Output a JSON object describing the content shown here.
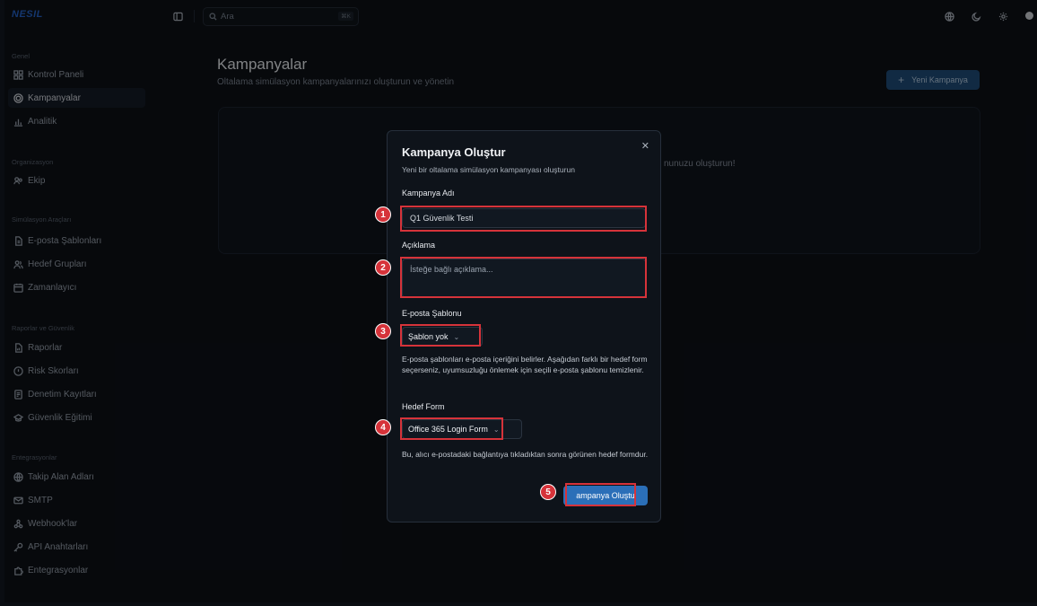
{
  "app": {
    "logo": "NESIL"
  },
  "search": {
    "placeholder": "Ara",
    "shortcut": "⌘K"
  },
  "sidebar": {
    "sections": [
      {
        "title": "Genel",
        "items": [
          {
            "label": "Kontrol Paneli",
            "icon": "dashboard-icon",
            "active": false
          },
          {
            "label": "Kampanyalar",
            "icon": "target-icon",
            "active": true
          },
          {
            "label": "Analitik",
            "icon": "bar-chart-icon",
            "active": false
          }
        ]
      },
      {
        "title": "Organizasyon",
        "items": [
          {
            "label": "Ekip",
            "icon": "users-icon",
            "active": false
          }
        ]
      },
      {
        "title": "Simülasyon Araçları",
        "items": [
          {
            "label": "E-posta Şablonları",
            "icon": "file-icon",
            "active": false
          },
          {
            "label": "Hedef Grupları",
            "icon": "user-group-icon",
            "active": false
          },
          {
            "label": "Zamanlayıcı",
            "icon": "calendar-icon",
            "active": false
          }
        ]
      },
      {
        "title": "Raporlar ve Güvenlik",
        "items": [
          {
            "label": "Raporlar",
            "icon": "report-icon",
            "active": false
          },
          {
            "label": "Risk Skorları",
            "icon": "alert-icon",
            "active": false
          },
          {
            "label": "Denetim Kayıtları",
            "icon": "log-icon",
            "active": false
          },
          {
            "label": "Güvenlik Eğitimi",
            "icon": "graduation-icon",
            "active": false
          }
        ]
      },
      {
        "title": "Entegrasyonlar",
        "items": [
          {
            "label": "Takip Alan Adları",
            "icon": "globe-icon",
            "active": false
          },
          {
            "label": "SMTP",
            "icon": "mail-icon",
            "active": false
          },
          {
            "label": "Webhook'lar",
            "icon": "webhook-icon",
            "active": false
          },
          {
            "label": "API Anahtarları",
            "icon": "key-icon",
            "active": false
          },
          {
            "label": "Entegrasyonlar",
            "icon": "puzzle-icon",
            "active": false
          }
        ]
      }
    ]
  },
  "page": {
    "title": "Kampanyalar",
    "subtitle": "Oltalama simülasyon kampanyalarınızı oluşturun ve yönetin",
    "new_button": "Yeni Kampanya",
    "empty_text_visible": "nunuzu oluşturun!"
  },
  "modal": {
    "title": "Kampanya Oluştur",
    "subtitle": "Yeni bir oltalama simülasyon kampanyası oluşturun",
    "name_label": "Kampanya Adı",
    "name_value": "Q1 Güvenlik Testi",
    "desc_label": "Açıklama",
    "desc_placeholder": "İsteğe bağlı açıklama...",
    "template_label": "E-posta Şablonu",
    "template_value": "Şablon yok",
    "template_help": "E-posta şablonları e-posta içeriğini belirler. Aşağıdan farklı bir hedef form seçerseniz, uyumsuzluğu önlemek için seçili e-posta şablonu temizlenir.",
    "form_label": "Hedef Form",
    "form_value": "Office 365 Login Form",
    "form_help": "Bu, alıcı e-postadaki bağlantıya tıkladıktan sonra görünen hedef formdur.",
    "submit_label": "Kampanya Oluştur",
    "submit_visible": "ampanya Oluştu"
  },
  "annotations": {
    "markers": [
      "1",
      "2",
      "3",
      "4",
      "5"
    ],
    "color": "#d6333a"
  },
  "colors": {
    "background": "#0d1117",
    "accent": "#2b6fb8",
    "brand": "#2563c9"
  }
}
